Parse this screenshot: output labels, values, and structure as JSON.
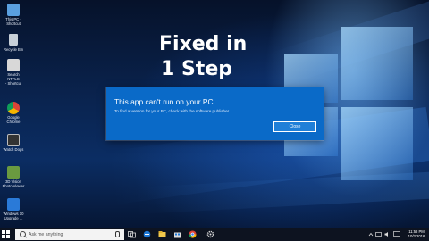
{
  "headline": {
    "line1": "Fixed in",
    "line2": "1 Step"
  },
  "desktop_icons": [
    {
      "label": "This PC -\nShortcut",
      "icon": "computer-icon",
      "color": "#5aa0e0"
    },
    {
      "label": "Recycle Bin",
      "icon": "recycle-bin-icon",
      "color": "#c8d0d8"
    },
    {
      "label": "Search NTFLC\n- Shortcut",
      "icon": "shortcut-icon",
      "color": "#d8d8d8"
    },
    {
      "label": "Google\nChrome",
      "icon": "chrome-icon",
      "color": "#e0b030"
    },
    {
      "label": "Watch Dogs",
      "icon": "watch-dogs-icon",
      "color": "#333333"
    },
    {
      "label": "3D Vision\nPhoto Viewer",
      "icon": "photo-viewer-icon",
      "color": "#6a9a40"
    },
    {
      "label": "Windows 10\nUpgrade ...",
      "icon": "windows-upgrade-icon",
      "color": "#2a7ad8"
    }
  ],
  "dialog": {
    "title": "This app can't run on your PC",
    "message": "To find a version for your PC, check with the software publisher.",
    "close_label": "Close"
  },
  "taskbar": {
    "search_placeholder": "Ask me anything",
    "pinned": [
      "task-view-icon",
      "edge-icon",
      "file-explorer-icon",
      "store-icon",
      "chrome-icon",
      "settings-icon"
    ],
    "clock_time": "11:58 PM",
    "clock_date": "10/3/2016"
  },
  "colors": {
    "dialog_bg": "#0a6ac8",
    "taskbar_bg": "#0d1320",
    "desktop_accent": "#1e5fc0"
  }
}
